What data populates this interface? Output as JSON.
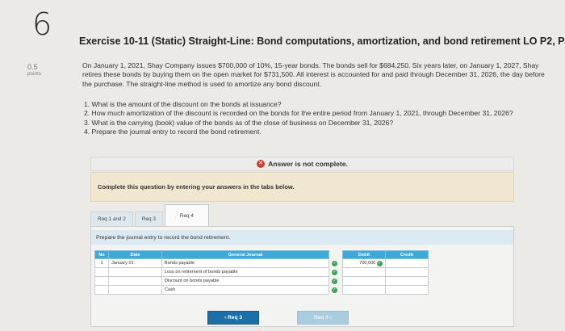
{
  "question": {
    "number": "6",
    "points_value": "0.5",
    "points_label": "points"
  },
  "exercise": {
    "title": "Exercise 10-11 (Static) Straight-Line: Bond computations, amortization, and bond retirement LO P2, P4",
    "intro": "On January 1, 2021, Shay Company issues $700,000 of 10%, 15-year bonds. The bonds sell for $684,250. Six years later, on January 1, 2027, Shay retires these bonds by buying them on the open market for $731,500. All interest is accounted for and paid through December 31, 2026, the day before the purchase. The straight-line method is used to amortize any bond discount.",
    "questions": [
      "1. What is the amount of the discount on the bonds at issuance?",
      "2. How much amortization of the discount is recorded on the bonds for the entire period from January 1, 2021, through December 31, 2026?",
      "3. What is the carrying (book) value of the bonds as of the close of business on December 31, 2026?",
      "4. Prepare the journal entry to record the bond retirement."
    ]
  },
  "status": {
    "text": "Answer is not complete."
  },
  "instructions": "Complete this question by entering your answers in the tabs below.",
  "tabs": [
    "Req 1 and 2",
    "Req 3",
    "Req 4"
  ],
  "active_tab": "Req 4",
  "panel_instruction": "Prepare the journal entry to record the bond retirement.",
  "journal": {
    "headers": {
      "no": "No",
      "date": "Date",
      "general_journal": "General Journal",
      "debit": "Debit",
      "credit": "Credit"
    },
    "rows": [
      {
        "no": "1",
        "date": "January 01",
        "account": "Bonds payable",
        "debit": "700,000",
        "credit": ""
      },
      {
        "no": "",
        "date": "",
        "account": "Loss on retirement of bonds payable",
        "debit": "",
        "credit": ""
      },
      {
        "no": "",
        "date": "",
        "account": "Discount on bonds payable",
        "debit": "",
        "credit": ""
      },
      {
        "no": "",
        "date": "",
        "account": "Cash",
        "debit": "",
        "credit": ""
      }
    ]
  },
  "nav": {
    "prev": "Req 3",
    "next": "Req 4"
  },
  "colors": {
    "header_blue": "#3ea8d8",
    "check_green": "#3aa35a",
    "error_red": "#d63a2b",
    "instr_bg": "#f1e7d1"
  }
}
